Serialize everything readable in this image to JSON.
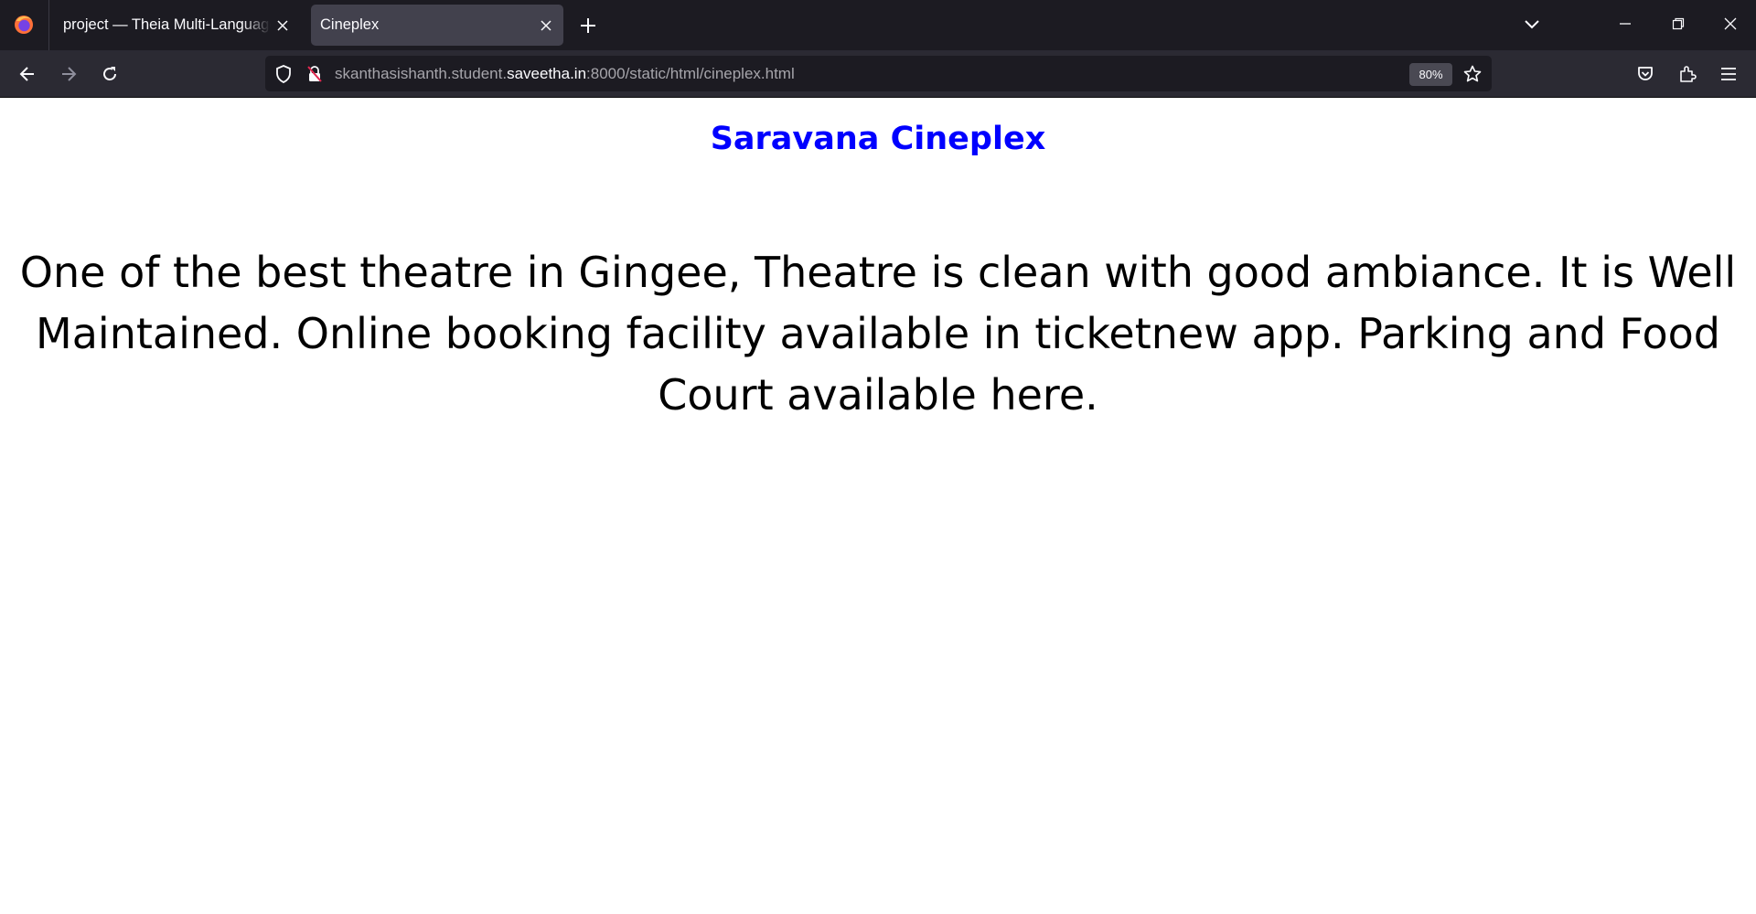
{
  "browser": {
    "tabs": [
      {
        "title": "project — Theia Multi-Language Explorer",
        "active": false
      },
      {
        "title": "Cineplex",
        "active": true
      }
    ],
    "url": {
      "prefix": "skanthasishanth.student.",
      "host": "saveetha.in",
      "suffix": ":8000/static/html/cineplex.html"
    },
    "zoom": "80%"
  },
  "page": {
    "heading": "Saravana Cineplex",
    "description": "One of the best theatre in Gingee, Theatre is clean with good ambiance. It is Well Maintained. Online booking facility available in ticketnew app. Parking and Food Court available here."
  },
  "icons": [
    "firefox-icon",
    "close-icon",
    "new-tab-icon",
    "tab-list-icon",
    "minimize-icon",
    "restore-icon",
    "window-close-icon",
    "back-icon",
    "forward-icon",
    "reload-icon",
    "tracking-protection-icon",
    "insecure-lock-icon",
    "bookmark-star-icon",
    "pocket-icon",
    "extensions-icon",
    "menu-icon"
  ],
  "colors": {
    "tabstrip": "#1c1b22",
    "toolbar": "#2b2a33",
    "active_tab": "#42414d",
    "heading": "#0000ff",
    "text": "#000000"
  }
}
